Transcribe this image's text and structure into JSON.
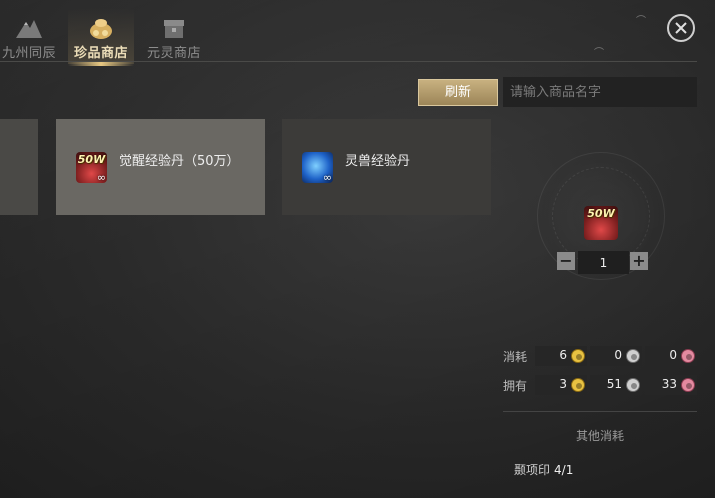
{
  "tabs": [
    {
      "label": "九州同辰",
      "icon": "mountain-icon",
      "active": false
    },
    {
      "label": "珍品商店",
      "icon": "treasure-bag-icon",
      "active": true
    },
    {
      "label": "元灵商店",
      "icon": "chest-icon",
      "active": false
    }
  ],
  "toolbar": {
    "refresh_label": "刷新",
    "search_placeholder": "请输入商品名字"
  },
  "items": [
    {
      "name": "觉醒经验丹（50万）",
      "icon_tag": "50W",
      "icon": "exp-pill-icon",
      "limit_symbol": "∞",
      "selected": true
    },
    {
      "name": "灵兽经验丹",
      "icon": "beast-exp-pill-icon",
      "limit_symbol": "∞",
      "selected": false
    }
  ],
  "detail": {
    "icon_tag": "50W",
    "quantity": "1",
    "minus": "−",
    "plus": "+",
    "cost_label": "消耗",
    "cost": [
      "6",
      "0",
      "0"
    ],
    "own_label": "拥有",
    "own": [
      "3",
      "51",
      "33"
    ],
    "other_cost_title": "其他消耗",
    "seal_label": "颞项印",
    "seal_value": "4/1"
  },
  "colors": {
    "accent": "#e8c882",
    "gold_coin": "#e8c242",
    "silver_coin": "#d0d0d0",
    "pink_coin": "#e38aa0"
  }
}
